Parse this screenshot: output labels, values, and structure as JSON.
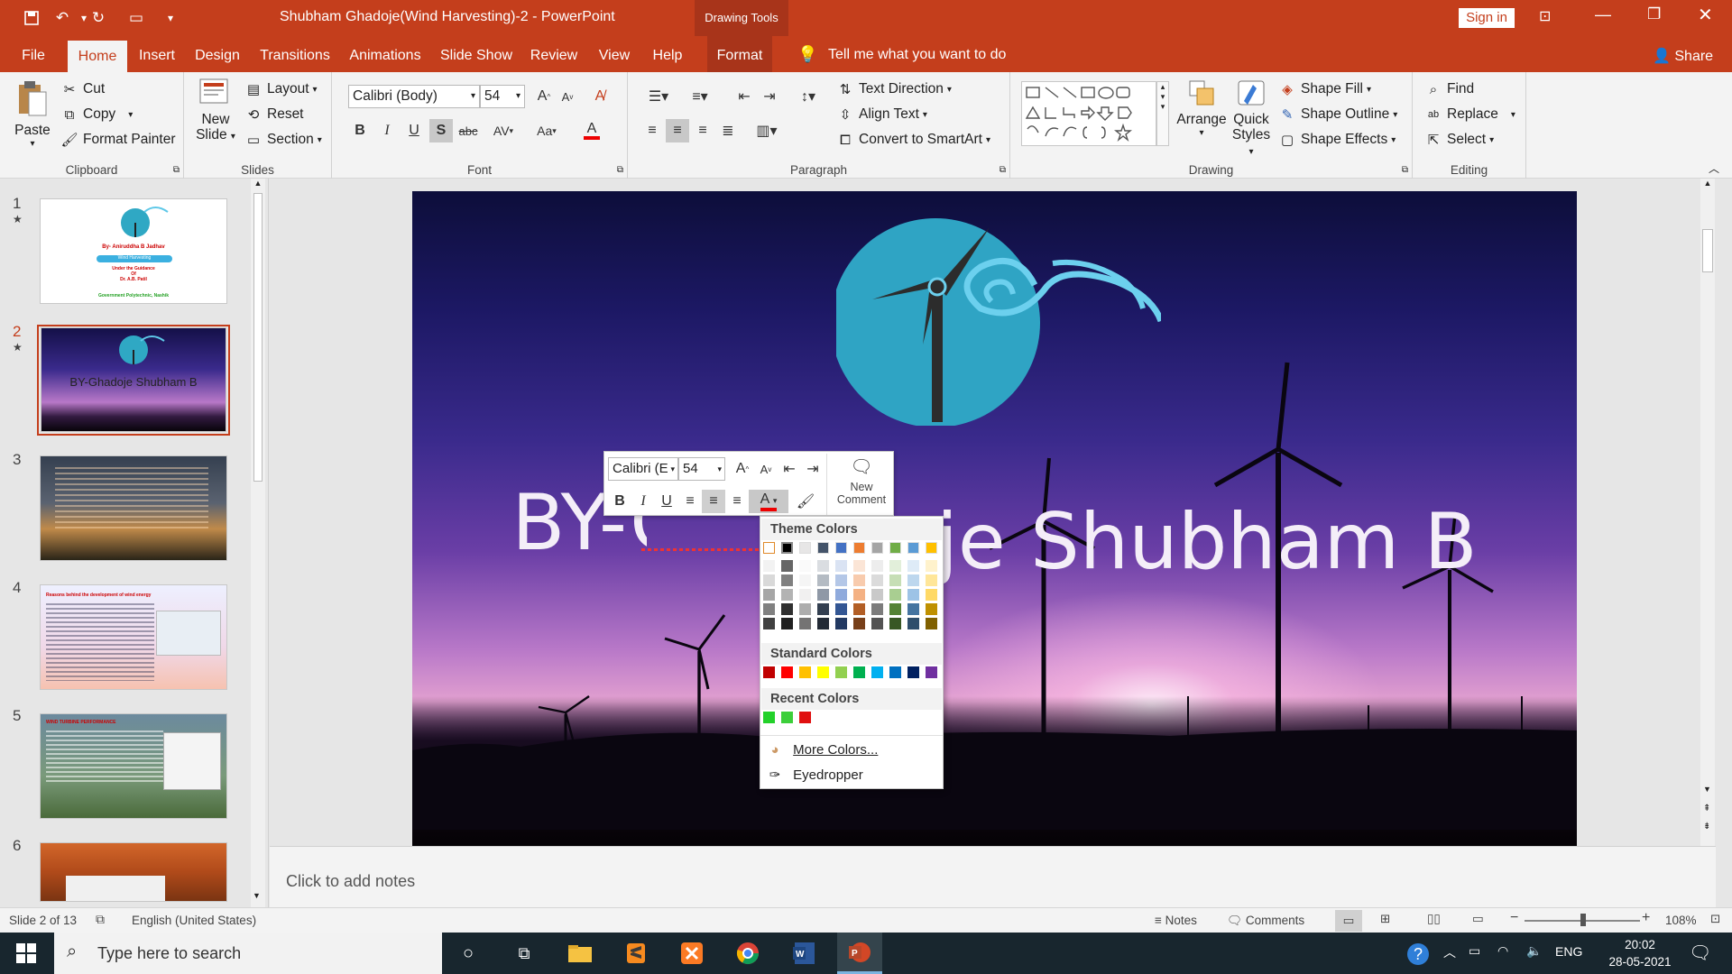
{
  "titlebar": {
    "title": "Shubham Ghadoje(Wind Harvesting)-2  -  PowerPoint",
    "contextual_tab": "Drawing Tools",
    "sign_in": "Sign in"
  },
  "tabs": [
    "File",
    "Home",
    "Insert",
    "Design",
    "Transitions",
    "Animations",
    "Slide Show",
    "Review",
    "View",
    "Help",
    "Format"
  ],
  "tell_me": "Tell me what you want to do",
  "share": "Share",
  "ribbon": {
    "clipboard": {
      "label": "Clipboard",
      "paste": "Paste",
      "cut": "Cut",
      "copy": "Copy",
      "format_painter": "Format Painter"
    },
    "slides": {
      "label": "Slides",
      "new_slide_1": "New",
      "new_slide_2": "Slide",
      "layout": "Layout",
      "reset": "Reset",
      "section": "Section"
    },
    "font": {
      "label": "Font",
      "font_name": "Calibri (Body)",
      "font_size": "54",
      "bold": "B",
      "italic": "I",
      "underline": "U",
      "shadow": "S",
      "strike": "abc",
      "spacing": "AV",
      "case": "Aa",
      "color": "A"
    },
    "paragraph": {
      "label": "Paragraph",
      "text_direction": "Text Direction",
      "align_text": "Align Text",
      "smartart": "Convert to SmartArt"
    },
    "drawing": {
      "label": "Drawing",
      "arrange": "Arrange",
      "quick_styles_1": "Quick",
      "quick_styles_2": "Styles",
      "shape_fill": "Shape Fill",
      "shape_outline": "Shape Outline",
      "shape_effects": "Shape Effects"
    },
    "editing": {
      "label": "Editing",
      "find": "Find",
      "replace": "Replace",
      "select": "Select"
    }
  },
  "thumbnails": [
    {
      "num": "1",
      "star": "★",
      "title": "By- Aniruddha B Jadhav",
      "sub1": "Wind Harvesting",
      "sub2": "Under the Guidance",
      "sub3": "Of",
      "sub4": "Dr. A.B. Patil",
      "footer": "Government Polytechnic, Nashik"
    },
    {
      "num": "2",
      "star": "★",
      "title": "BY-Ghadoje Shubham B"
    },
    {
      "num": "3"
    },
    {
      "num": "4",
      "title": "Reasons behind the development of wind energy"
    },
    {
      "num": "5",
      "title": "WIND TURBINE PERFORMANCE"
    },
    {
      "num": "6"
    }
  ],
  "slide": {
    "title": "BY-Ghadoje Shubham B",
    "title_visible_left": "BY-G",
    "title_visible_right": "oje Shubham B"
  },
  "mini_toolbar": {
    "font": "Calibri (E",
    "size": "54",
    "new_comment_1": "New",
    "new_comment_2": "Comment",
    "bold": "B",
    "italic": "I",
    "underline": "U"
  },
  "color_menu": {
    "theme_colors": "Theme Colors",
    "standard_colors": "Standard Colors",
    "recent_colors": "Recent Colors",
    "more_colors": "More Colors...",
    "eyedropper": "Eyedropper",
    "theme_top": [
      "#ffffff",
      "#000000",
      "#e7e6e6",
      "#44546a",
      "#4472c4",
      "#ed7d31",
      "#a5a5a5",
      "#70ad47",
      "#5b9bd5",
      "#ffc000"
    ],
    "standard": [
      "#c00000",
      "#ff0000",
      "#ffc000",
      "#ffff00",
      "#92d050",
      "#00b050",
      "#00b0f0",
      "#0070c0",
      "#002060",
      "#7030a0"
    ],
    "recent": [
      "#23d12a",
      "#3ccf3a",
      "#e01010"
    ]
  },
  "notes_placeholder": "Click to add notes",
  "status": {
    "slide_info": "Slide 2 of 13",
    "language": "English (United States)",
    "notes": "Notes",
    "comments": "Comments",
    "zoom": "108%"
  },
  "taskbar": {
    "search": "Type here to search",
    "lang": "ENG",
    "time": "20:02",
    "date": "28-05-2021"
  },
  "colors": {
    "accent": "#c43e1c",
    "taskbar": "#18262e"
  }
}
